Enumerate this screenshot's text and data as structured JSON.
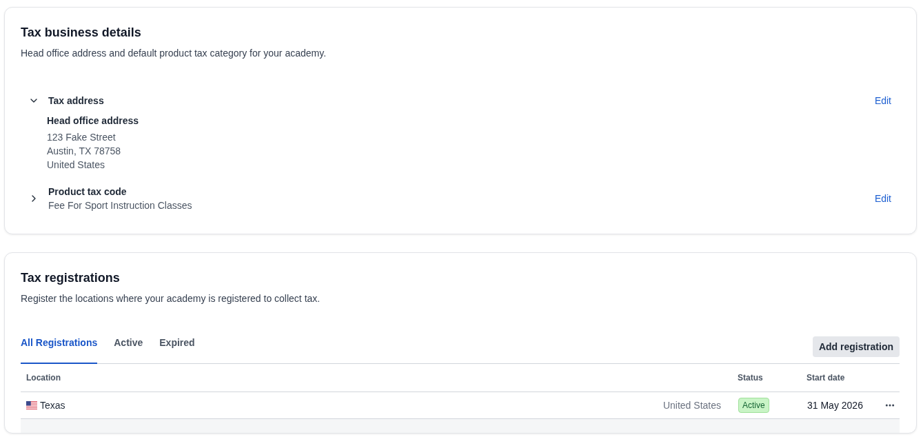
{
  "tax_business_details": {
    "title": "Tax business details",
    "subtitle": "Head office address and default product tax category for your academy.",
    "sections": [
      {
        "title": "Tax address",
        "expanded": true,
        "action": "Edit",
        "details": {
          "label": "Head office address",
          "lines": [
            "123 Fake Street",
            "Austin, TX 78758",
            "United States"
          ]
        }
      },
      {
        "title": "Product tax code",
        "expanded": false,
        "action": "Edit",
        "summary": "Fee For Sport Instruction Classes"
      }
    ]
  },
  "tax_registrations": {
    "title": "Tax registrations",
    "subtitle": "Register the locations where your academy is registered to collect tax.",
    "tabs": [
      {
        "label": "All Registrations",
        "selected": true
      },
      {
        "label": "Active",
        "selected": false
      },
      {
        "label": "Expired",
        "selected": false
      }
    ],
    "add_button": "Add registration",
    "table": {
      "columns": {
        "location": "Location",
        "status": "Status",
        "start_date": "Start date"
      },
      "rows": [
        {
          "location": "Texas",
          "country": "United States",
          "status": "Active",
          "start_date": "31 May 2026"
        }
      ]
    }
  }
}
